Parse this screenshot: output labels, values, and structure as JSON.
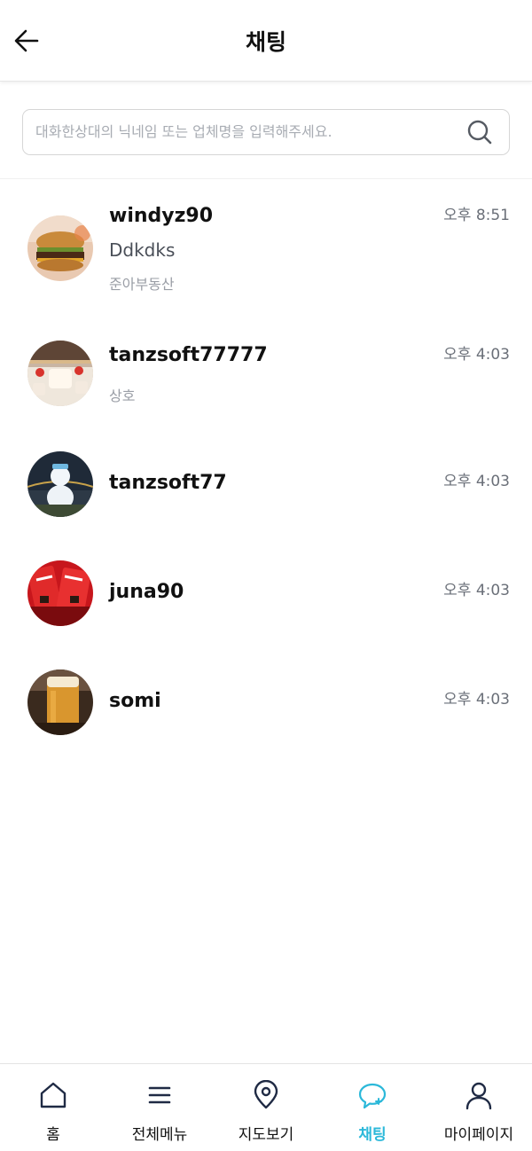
{
  "header": {
    "title": "채팅"
  },
  "search": {
    "placeholder": "대화한상대의 닉네임 또는 업체명을 입력해주세요.",
    "value": ""
  },
  "chats": [
    {
      "name": "windyz90",
      "time": "오후 8:51",
      "message": "Ddkdks",
      "sub": "준아부동산"
    },
    {
      "name": "tanzsoft77777",
      "time": "오후 4:03",
      "message": "",
      "sub": "상호"
    },
    {
      "name": "tanzsoft77",
      "time": "오후 4:03",
      "message": "",
      "sub": ""
    },
    {
      "name": "juna90",
      "time": "오후 4:03",
      "message": "",
      "sub": ""
    },
    {
      "name": "somi",
      "time": "오후 4:03",
      "message": "",
      "sub": ""
    }
  ],
  "nav": [
    {
      "label": "홈",
      "icon": "home-icon"
    },
    {
      "label": "전체메뉴",
      "icon": "menu-icon"
    },
    {
      "label": "지도보기",
      "icon": "map-pin-icon"
    },
    {
      "label": "채팅",
      "icon": "chat-icon",
      "active": true
    },
    {
      "label": "마이페이지",
      "icon": "user-icon"
    }
  ],
  "colors": {
    "accent": "#2bb8d9",
    "text": "#111111",
    "muted": "#6a6f78"
  }
}
